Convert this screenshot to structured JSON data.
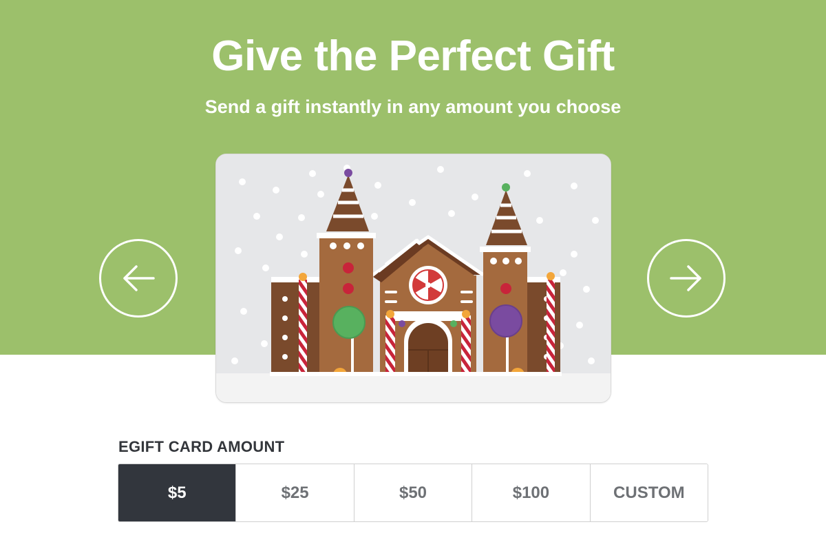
{
  "hero": {
    "title": "Give the Perfect Gift",
    "subtitle": "Send a gift instantly in any amount you choose",
    "background_color": "#9cc06b"
  },
  "carousel": {
    "prev_icon": "arrow-left-icon",
    "next_icon": "arrow-right-icon",
    "current_card_image": "gingerbread-house"
  },
  "amount": {
    "label": "EGIFT CARD AMOUNT",
    "options": [
      "$5",
      "$25",
      "$50",
      "$100",
      "CUSTOM"
    ],
    "selected": "$5",
    "selected_color": "#32363d"
  }
}
